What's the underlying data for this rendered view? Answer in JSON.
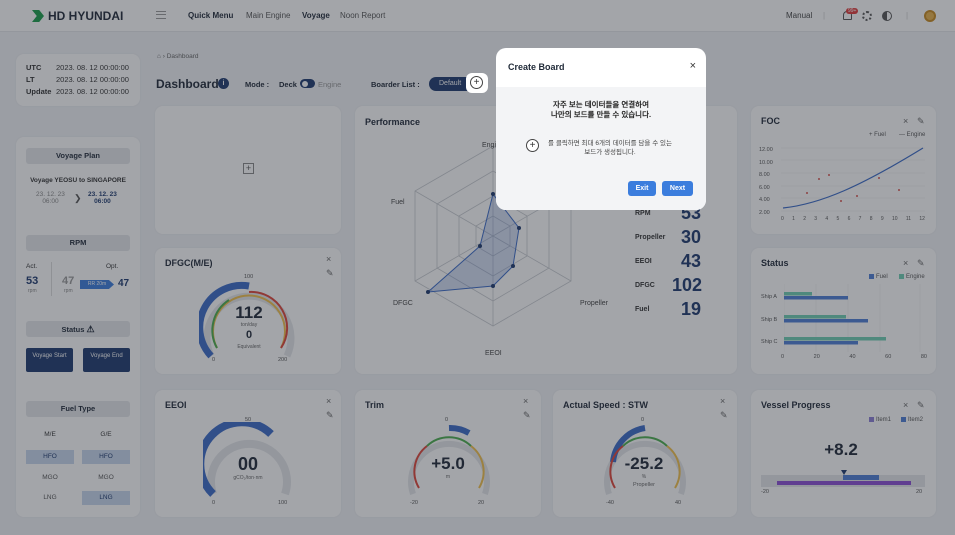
{
  "header": {
    "brand": "HD HYUNDAI",
    "nav": [
      "Quick Menu",
      "Main Engine",
      "Voyage",
      "Noon Report"
    ],
    "mode_label": "Manual",
    "notif_badge": "99+"
  },
  "times": [
    {
      "label": "UTC",
      "value": "2023. 08. 12 00:00:00"
    },
    {
      "label": "LT",
      "value": "2023. 08. 12 00:00:00"
    },
    {
      "label": "Update",
      "value": "2023. 08. 12 00:00:00"
    }
  ],
  "sidebar": {
    "voyage_plan_title": "Voyage Plan",
    "voyage_route": "Voyage YEOSU to SINGAPORE",
    "from_date": "23. 12. 23",
    "from_time": "06:00",
    "to_date": "23. 12. 23",
    "to_time": "06:00",
    "rpm_title": "RPM",
    "rpm_act_label": "Act.",
    "rpm_act_value": "53",
    "rpm_act_unit": "rpm",
    "rpm_mid_value": "47",
    "rpm_mid_unit": "rpm",
    "rpm_opt_label": "Opt.",
    "rpm_opt_pill": "RR 20m",
    "rpm_opt_value": "47",
    "status_title": "Status",
    "voyage_start": "Voyage Start",
    "voyage_end": "Voyage End",
    "fuel_type_title": "Fuel Type",
    "me_label": "M/E",
    "ge_label": "G/E",
    "fuels_me": [
      "HFO",
      "MGO",
      "LNG"
    ],
    "fuels_ge": [
      "HFO",
      "MGO",
      "LNG"
    ]
  },
  "main": {
    "breadcrumb": "Dashboard",
    "title": "Dashboard",
    "info_badge": "i",
    "mode_label": "Mode",
    "mode_deck": "Deck",
    "mode_engine": "Engine",
    "boarder_list_label": "Boarder List",
    "default_chip": "Default"
  },
  "dfgc": {
    "title": "DFGC(M/E)",
    "value": "112",
    "unit": "ton/day",
    "sub_value": "0",
    "sub_label": "Equivalent",
    "min": "0",
    "mid": "100",
    "max": "200"
  },
  "performance": {
    "title": "Performance",
    "axes": [
      "Engine",
      "Propeller",
      "EEOI",
      "DFGC",
      "Fuel"
    ],
    "values": [
      0.25,
      0.3,
      0.5,
      0.8,
      0.6,
      0.4
    ],
    "stats": [
      {
        "label": "RPM",
        "value": "53"
      },
      {
        "label": "Propeller",
        "value": "30"
      },
      {
        "label": "EEOI",
        "value": "43"
      },
      {
        "label": "DFGC",
        "value": "102"
      },
      {
        "label": "Fuel",
        "value": "19"
      }
    ]
  },
  "foc": {
    "title": "FOC",
    "legend_fuel": "Fuel",
    "legend_engine": "Engine",
    "yticks": [
      "12.00",
      "10.00",
      "8.00",
      "6.00",
      "4.00",
      "2.00"
    ],
    "xticks": [
      "0",
      "1",
      "2",
      "3",
      "4",
      "5",
      "6",
      "7",
      "8",
      "9",
      "10",
      "11",
      "12"
    ]
  },
  "status_card": {
    "title": "Status",
    "legend_fuel": "Fuel",
    "legend_engine": "Engine",
    "ships": [
      "Ship A",
      "Ship B",
      "Ship C"
    ],
    "xticks": [
      "0",
      "20",
      "40",
      "60",
      "80"
    ],
    "colors": {
      "fuel": "#4f7fd6",
      "engine": "#6ecfb4"
    }
  },
  "eeoi": {
    "title": "EEOI",
    "value": "00",
    "unit": "gCO₂/ton·nm",
    "min": "0",
    "mid": "50",
    "max": "100"
  },
  "trim": {
    "title": "Trim",
    "value": "+5.0",
    "unit": "m",
    "min": "-20",
    "mid": "0",
    "max": "20"
  },
  "speed": {
    "title": "Actual Speed : STW",
    "value": "-25.2",
    "unit": "%",
    "sub": "Propeller",
    "min": "-40",
    "mid": "0",
    "max": "40"
  },
  "progress": {
    "title": "Vessel Progress",
    "legend1": "Item1",
    "legend2": "Item2",
    "value": "+8.2",
    "min": "-20",
    "max": "20"
  },
  "modal": {
    "title": "Create Board",
    "message_line1": "자주 보는 데이터들을 연결하여",
    "message_line2": "나만의 보드를 만들 수 있습니다.",
    "hint_line1": "를 클릭하면 최대 6개의 데이터를 담을 수 있는",
    "hint_line2": "보드가 생성됩니다.",
    "exit_label": "Exit",
    "next_label": "Next"
  }
}
